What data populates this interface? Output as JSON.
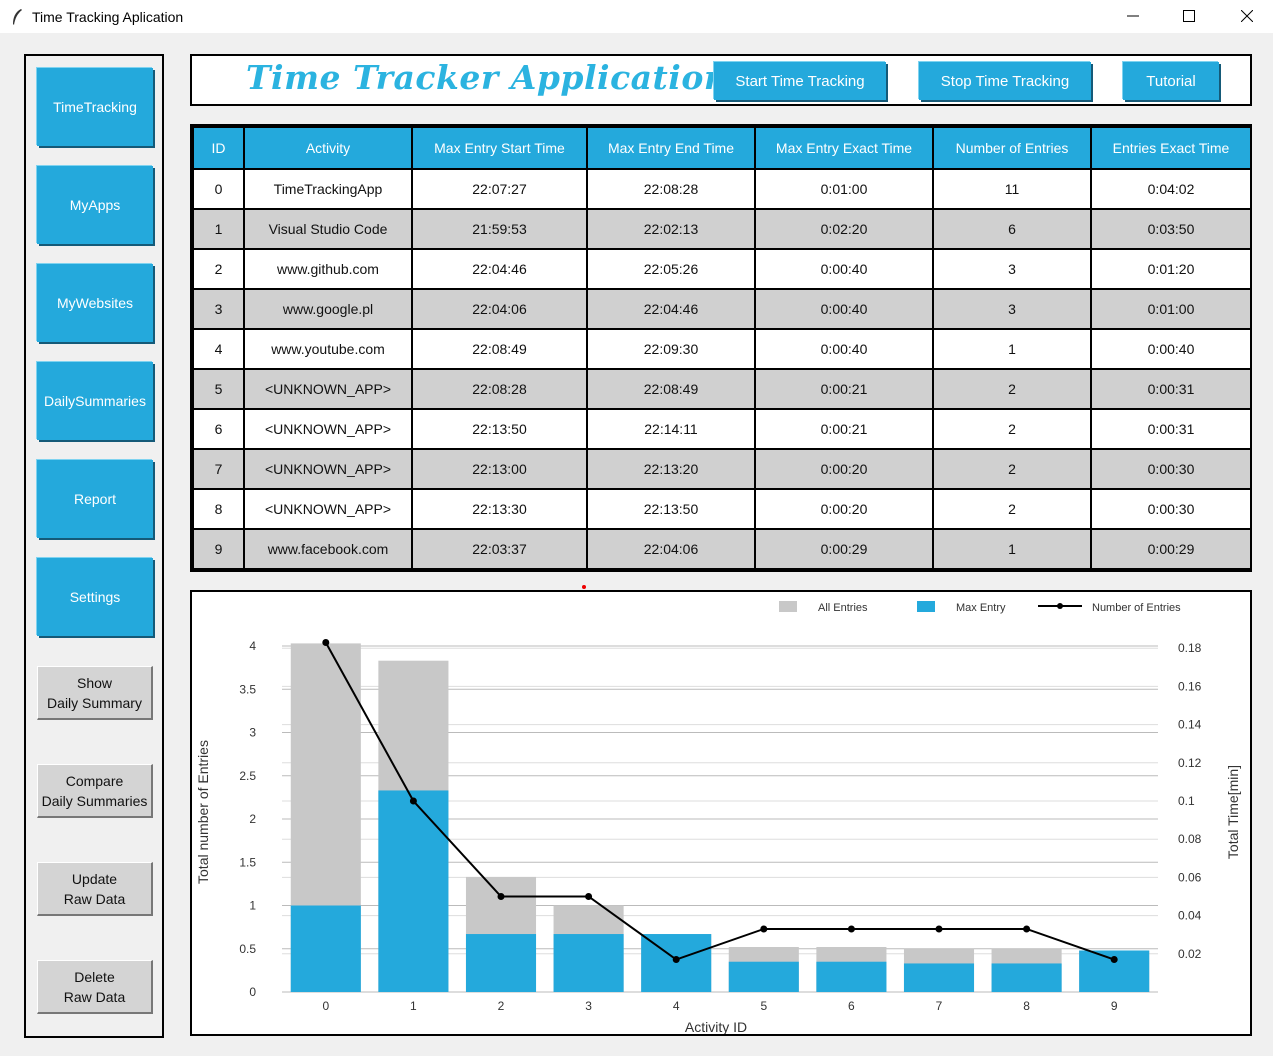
{
  "window": {
    "title": "Time Tracking Aplication"
  },
  "sidebar": {
    "nav": [
      {
        "label": "TimeTracking"
      },
      {
        "label": "MyApps"
      },
      {
        "label": "MyWebsites"
      },
      {
        "label": "DailySummaries"
      },
      {
        "label": "Report"
      },
      {
        "label": "Settings"
      }
    ],
    "actions": [
      {
        "label": "Show\nDaily Summary"
      },
      {
        "label": "Compare\nDaily Summaries"
      },
      {
        "label": "Update\nRaw Data"
      },
      {
        "label": "Delete\nRaw Data"
      }
    ]
  },
  "header": {
    "title": "Time Tracker Application",
    "start_label": "Start Time Tracking",
    "stop_label": "Stop Time Tracking",
    "tutorial_label": "Tutorial"
  },
  "table": {
    "columns": [
      "ID",
      "Activity",
      "Max Entry Start Time",
      "Max Entry End Time",
      "Max Entry Exact Time",
      "Number of Entries",
      "Entries Exact Time"
    ],
    "rows": [
      [
        "0",
        "TimeTrackingApp",
        "22:07:27",
        "22:08:28",
        "0:01:00",
        "11",
        "0:04:02"
      ],
      [
        "1",
        "Visual Studio Code",
        "21:59:53",
        "22:02:13",
        "0:02:20",
        "6",
        "0:03:50"
      ],
      [
        "2",
        "www.github.com",
        "22:04:46",
        "22:05:26",
        "0:00:40",
        "3",
        "0:01:20"
      ],
      [
        "3",
        "www.google.pl",
        "22:04:06",
        "22:04:46",
        "0:00:40",
        "3",
        "0:01:00"
      ],
      [
        "4",
        "www.youtube.com",
        "22:08:49",
        "22:09:30",
        "0:00:40",
        "1",
        "0:00:40"
      ],
      [
        "5",
        "<UNKNOWN_APP>",
        "22:08:28",
        "22:08:49",
        "0:00:21",
        "2",
        "0:00:31"
      ],
      [
        "6",
        "<UNKNOWN_APP>",
        "22:13:50",
        "22:14:11",
        "0:00:21",
        "2",
        "0:00:31"
      ],
      [
        "7",
        "<UNKNOWN_APP>",
        "22:13:00",
        "22:13:20",
        "0:00:20",
        "2",
        "0:00:30"
      ],
      [
        "8",
        "<UNKNOWN_APP>",
        "22:13:30",
        "22:13:50",
        "0:00:20",
        "2",
        "0:00:30"
      ],
      [
        "9",
        "www.facebook.com",
        "22:03:37",
        "22:04:06",
        "0:00:29",
        "1",
        "0:00:29"
      ]
    ]
  },
  "colors": {
    "accent": "#24a9dc",
    "all_entries": "#c8c8c8",
    "line": "#000000"
  },
  "chart_data": {
    "type": "bar",
    "categories": [
      "0",
      "1",
      "2",
      "3",
      "4",
      "5",
      "6",
      "7",
      "8",
      "9"
    ],
    "xlabel": "Activity ID",
    "ylabel": "Total number of Entries",
    "y2label": "Total Time[min]",
    "ylim": [
      0,
      4
    ],
    "y_ticks": [
      "0",
      "0.5",
      "1",
      "1.5",
      "2",
      "2.5",
      "3",
      "3.5",
      "4"
    ],
    "y2_ticks": [
      "0.02",
      "0.04",
      "0.06",
      "0.08",
      "0.1",
      "0.12",
      "0.14",
      "0.16",
      "0.18"
    ],
    "y2lim": [
      0,
      0.2
    ],
    "legend_position": "top-right",
    "series": [
      {
        "name": "All Entries",
        "kind": "bar",
        "axis": "left",
        "values": [
          4.03,
          3.83,
          1.33,
          1.0,
          0.67,
          0.52,
          0.52,
          0.5,
          0.5,
          0.48
        ]
      },
      {
        "name": "Max Entry",
        "kind": "bar",
        "axis": "left",
        "values": [
          1.0,
          2.33,
          0.67,
          0.67,
          0.67,
          0.35,
          0.35,
          0.33,
          0.33,
          0.48
        ]
      },
      {
        "name": "Number of Entries",
        "kind": "line",
        "axis": "right",
        "values": [
          0.183,
          0.1,
          0.05,
          0.05,
          0.017,
          0.033,
          0.033,
          0.033,
          0.033,
          0.017
        ]
      }
    ]
  }
}
